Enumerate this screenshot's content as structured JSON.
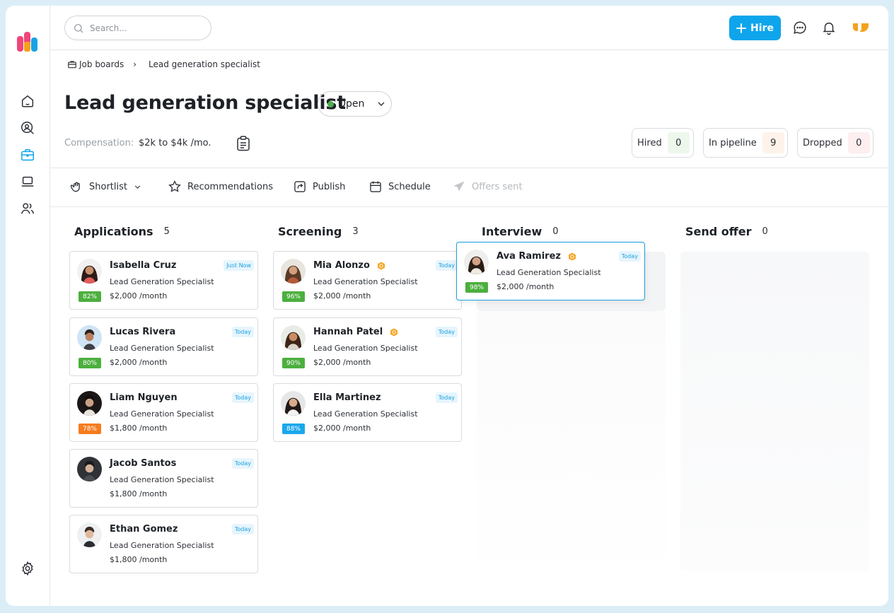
{
  "search": {
    "placeholder": "Search..."
  },
  "header": {
    "hire_label": "Hire"
  },
  "breadcrumb": {
    "root": "Job boards",
    "current": "Lead generation specialist"
  },
  "job": {
    "title": "Lead generation specialist",
    "status": "Open",
    "compensation_label": "Compensation:",
    "compensation_value": "$2k to $4k /mo."
  },
  "stats": [
    {
      "label": "Hired",
      "value": "0",
      "bg": "#eef7ec"
    },
    {
      "label": "In pipeline",
      "value": "9",
      "bg": "#fdf3ea"
    },
    {
      "label": "Dropped",
      "value": "0",
      "bg": "#fdeef0"
    }
  ],
  "toolbar": {
    "shortlist": "Shortlist",
    "recommendations": "Recommendations",
    "publish": "Publish",
    "schedule": "Schedule",
    "offers_sent": "Offers sent"
  },
  "columns": [
    {
      "title": "Applications",
      "count": "5",
      "cards": [
        {
          "name": "Isabella Cruz",
          "role": "Lead Generation Specialist",
          "pay": "$2,000 /month",
          "score": "82%",
          "score_color": "#4caf3e",
          "tag": "Just Now",
          "badge": false
        },
        {
          "name": "Lucas Rivera",
          "role": "Lead Generation Specialist",
          "pay": "$2,000 /month",
          "score": "80%",
          "score_color": "#4caf3e",
          "tag": "Today",
          "badge": false
        },
        {
          "name": "Liam Nguyen",
          "role": "Lead Generation Specialist",
          "pay": "$1,800 /month",
          "score": "78%",
          "score_color": "#f57c1f",
          "tag": "Today",
          "badge": false
        },
        {
          "name": "Jacob Santos",
          "role": "Lead Generation Specialist",
          "pay": "$1,800 /month",
          "score": "",
          "score_color": "",
          "tag": "Today",
          "badge": false
        },
        {
          "name": "Ethan Gomez",
          "role": "Lead Generation Specialist",
          "pay": "$1,800 /month",
          "score": "",
          "score_color": "",
          "tag": "Today",
          "badge": false
        }
      ]
    },
    {
      "title": "Screening",
      "count": "3",
      "cards": [
        {
          "name": "Mia Alonzo",
          "role": "Lead Generation Specialist",
          "pay": "$2,000 /month",
          "score": "96%",
          "score_color": "#4caf3e",
          "tag": "Today",
          "badge": true
        },
        {
          "name": "Hannah Patel",
          "role": "Lead Generation Specialist",
          "pay": "$2,000 /month",
          "score": "90%",
          "score_color": "#4caf3e",
          "tag": "Today",
          "badge": true
        },
        {
          "name": "Ella Martinez",
          "role": "Lead Generation Specialist",
          "pay": "$2,000 /month",
          "score": "88%",
          "score_color": "#1aa7ec",
          "tag": "Today",
          "badge": false
        }
      ]
    },
    {
      "title": "Interview",
      "count": "0",
      "cards": []
    },
    {
      "title": "Send offer",
      "count": "0",
      "cards": []
    }
  ],
  "dragging_card": {
    "name": "Ava Ramirez",
    "role": "Lead Generation Specialist",
    "pay": "$2,000 /month",
    "score": "98%",
    "score_color": "#4caf3e",
    "tag": "Today",
    "badge": true
  },
  "colors": {
    "accent": "#0ea5ec",
    "logo_pink": "#f0457a",
    "logo_blue": "#19a3e6",
    "logo_orange": "#f4a11c",
    "badge": "#f6a623"
  },
  "icons": [
    "home-icon",
    "user-search-icon",
    "briefcase-icon",
    "laptop-icon",
    "users-icon",
    "settings-icon",
    "chat-icon",
    "bell-icon"
  ]
}
